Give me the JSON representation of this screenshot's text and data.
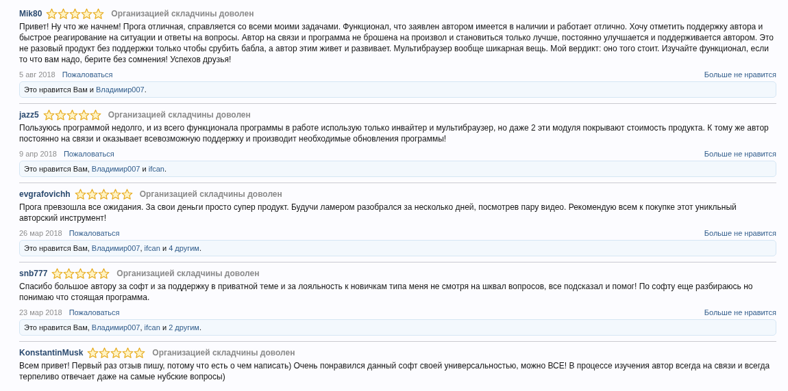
{
  "reviews": [
    {
      "author": "Mik80",
      "stars": 5,
      "rating_text": "Организацией складчины доволен",
      "body": "Привет! Ну что же начнем! Прога отличная, справляется со всеми моими задачами. Функционал, что заявлен автором имеется в наличии и работает отлично. Хочу отметить поддержку автора и быстрое реагирование на ситуации и ответы на вопросы. Автор на связи и программа не брошена на произвол и становиться только лучше, постоянно улучшается и поддерживается автором. Это не разовый продукт без поддержки только чтобы срубить бабла, а автор этим живет и развивает. Мультибраузер вообще шикарная вещь. Мой вердикт: оно того стоит. Изучайте функционал, если то что вам надо, берите без сомнения! Успехов друзья!",
      "date": "5 авг 2018",
      "report": "Пожаловаться",
      "unlike": "Больше не нравится",
      "likes": [
        "Это нравится Вам и ",
        {
          "user": "Владимир007"
        },
        "."
      ]
    },
    {
      "author": "jazz5",
      "stars": 5,
      "rating_text": "Организацией складчины доволен",
      "body": "Пользуюсь программой недолго, и из всего функционала программы в работе использую только инвайтер и мультибраузер, но даже 2 эти модуля покрывают стоимость продукта. К тому же автор постоянно на связи и оказывает всевозможную поддержку и производит необходимые обновления программы!",
      "date": "9 апр 2018",
      "report": "Пожаловаться",
      "unlike": "Больше не нравится",
      "likes": [
        "Это нравится Вам, ",
        {
          "user": "Владимир007"
        },
        " и ",
        {
          "user": "ifcan"
        },
        "."
      ]
    },
    {
      "author": "evgrafovichh",
      "stars": 5,
      "rating_text": "Организацией складчины доволен",
      "body": "Прога превзошла все ожидания. За свои деньги просто супер продукт. Будучи ламером разобрался за несколько дней, посмотрев пару видео. Рекомендую всем к покупке этот уникльный авторский инструмент!",
      "date": "26 мар 2018",
      "report": "Пожаловаться",
      "unlike": "Больше не нравится",
      "likes": [
        "Это нравится Вам, ",
        {
          "user": "Владимир007"
        },
        ", ",
        {
          "user": "ifcan"
        },
        " и ",
        {
          "user": "4 другим"
        },
        "."
      ]
    },
    {
      "author": "snb777",
      "stars": 5,
      "rating_text": "Организацией складчины доволен",
      "body": "Спасибо большое автору за софт и за поддержку в приватной теме и за лояльность к новичкам типа меня не смотря на шквал вопросов, все подсказал и помог! По софту еще разбираюсь но понимаю что стоящая программа.",
      "date": "23 мар 2018",
      "report": "Пожаловаться",
      "unlike": "Больше не нравится",
      "likes": [
        "Это нравится Вам, ",
        {
          "user": "Владимир007"
        },
        ", ",
        {
          "user": "ifcan"
        },
        " и ",
        {
          "user": "2 другим"
        },
        "."
      ]
    },
    {
      "author": "KonstantinMusk",
      "stars": 5,
      "rating_text": "Организацией складчины доволен",
      "body": "Всем привет! Первый раз отзыв пишу, потому что есть о чем написать) Очень понравился данный софт своей универсальностью, можно ВСЕ! В процессе изучения автор всегда на связи и всегда терпеливо отвечает даже на самые нубские вопросы)"
    }
  ]
}
